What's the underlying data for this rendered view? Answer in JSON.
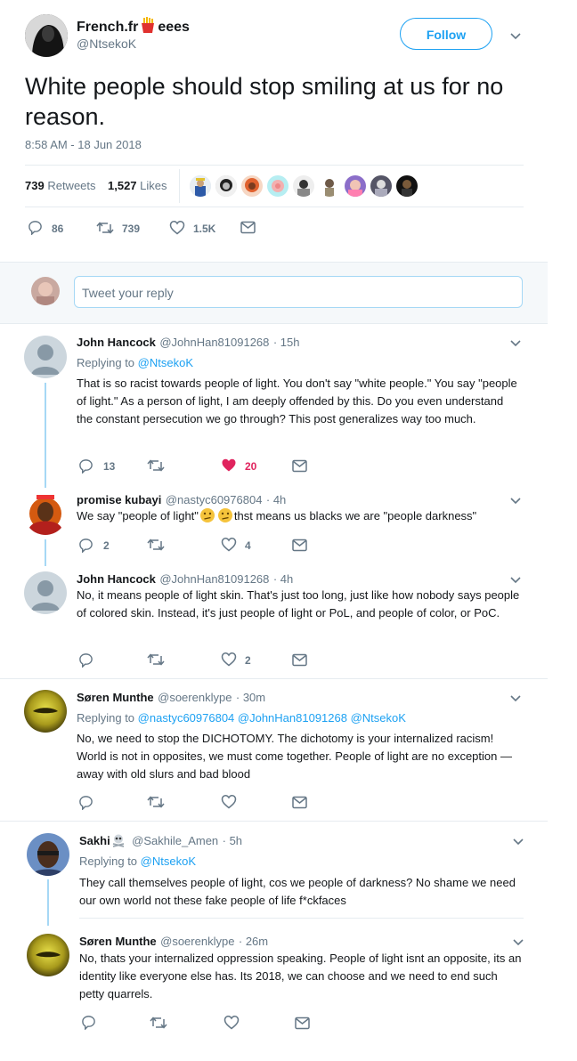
{
  "tweet": {
    "author_name": "French.fr",
    "author_name_suffix": "eees",
    "author_handle": "@NtsekoK",
    "follow_label": "Follow",
    "text": "White people should stop smiling at us for no reason.",
    "timestamp": "8:58 AM - 18 Jun 2018",
    "retweets_count": "739",
    "retweets_label": "Retweets",
    "likes_count": "1,527",
    "likes_label": "Likes",
    "actions": {
      "replies": "86",
      "retweets": "739",
      "likes": "1.5K"
    }
  },
  "reply_box": {
    "placeholder": "Tweet your reply"
  },
  "replies": [
    {
      "name": "John Hancock",
      "handle": "@JohnHan81091268",
      "time": "· 15h",
      "replying_label": "Replying to",
      "replying_to": "@NtsekoK",
      "text": "That is so racist towards people of light. You don't say \"white people.\" You say \"people of light.\" As a person of light, I am deeply offended by this. Do you even understand the constant persecution we go through? This post generalizes way too much.",
      "replies": "13",
      "retweets": "",
      "likes": "20",
      "liked": true
    },
    {
      "name": "promise kubayi",
      "handle": "@nastyc60976804",
      "time": "· 4h",
      "text_before": "We say \"people of light\"",
      "text_after": "thst means us blacks we are \"people darkness\"",
      "replies": "2",
      "retweets": "",
      "likes": "4"
    },
    {
      "name": "John Hancock",
      "handle": "@JohnHan81091268",
      "time": "· 4h",
      "text": "No, it means people of light skin. That's just too long, just like how nobody says people of colored skin. Instead, it's just people of light or PoL, and people of color, or PoC.",
      "replies": "",
      "retweets": "",
      "likes": "2"
    },
    {
      "name": "Søren Munthe",
      "handle": "@soerenklype",
      "time": "· 30m",
      "replying_label": "Replying to",
      "replying_to": "@nastyc60976804 @JohnHan81091268 @NtsekoK",
      "text": "No, we need to stop the DICHOTOMY. The dichotomy is your internalized racism! World is not in opposites, we must come together. People of light are no exception — away with old slurs and bad blood",
      "replies": "",
      "retweets": "",
      "likes": ""
    },
    {
      "name": "Sakhi",
      "handle": "@Sakhile_Amen",
      "time": "· 5h",
      "replying_label": "Replying to",
      "replying_to": "@NtsekoK",
      "text": "They call themselves people of light, cos we people of darkness? No shame we need our own world not these fake people of life f*ckfaces"
    },
    {
      "name": "Søren Munthe",
      "handle": "@soerenklype",
      "time": "· 26m",
      "text": "No, thats your internalized oppression speaking. People of light isnt an opposite, its an identity like everyone else has. Its 2018, we can choose and we need to end such petty quarrels.",
      "replies": "",
      "retweets": "",
      "likes": ""
    }
  ],
  "colors": {
    "accent": "#1da1f2",
    "liked": "#e0245e",
    "gray": "#657786",
    "divider": "#e6ecf0",
    "thread_line": "#a6d8f5"
  },
  "icons": [
    "reply-icon",
    "retweet-icon",
    "like-icon",
    "dm-icon",
    "chevron-down-icon",
    "fries-emoji",
    "confused-emoji",
    "skull-emoji"
  ]
}
